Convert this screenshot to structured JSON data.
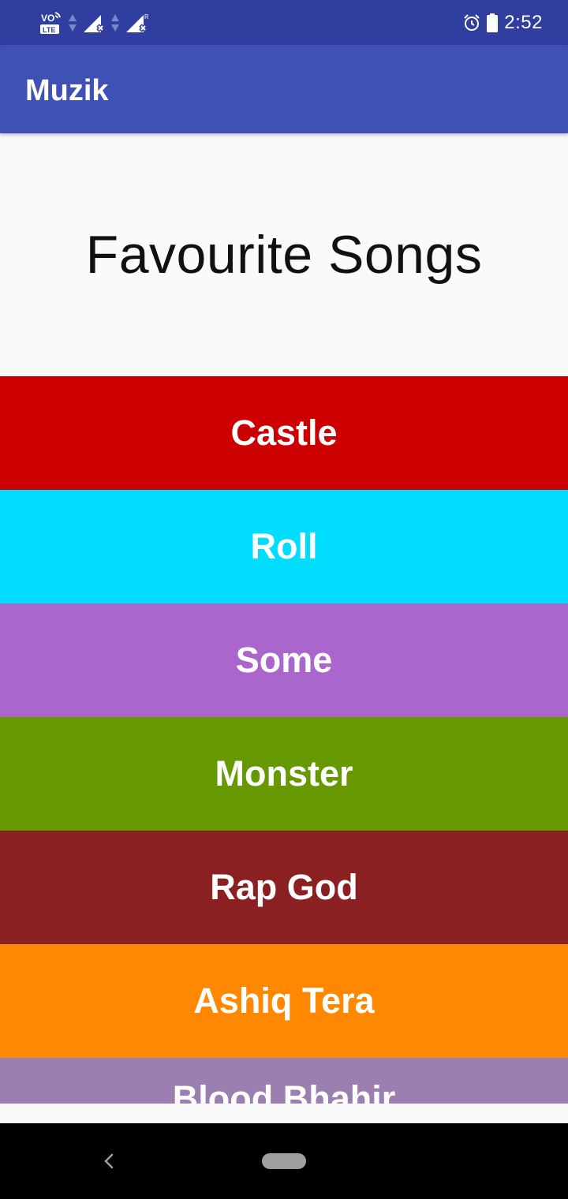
{
  "status_bar": {
    "time": "2:52",
    "volte_top": "VO",
    "volte_bottom": "LTE",
    "roaming": "R",
    "icons": [
      "volte-icon",
      "data-arrows-icon",
      "signal-icon",
      "signal-icon",
      "alarm-icon",
      "battery-icon"
    ]
  },
  "app_bar": {
    "title": "Muzik"
  },
  "header": {
    "title": "Favourite Songs"
  },
  "songs": [
    {
      "title": "Castle",
      "color": "#cc0000"
    },
    {
      "title": "Roll",
      "color": "#00ddff"
    },
    {
      "title": "Some",
      "color": "#aa66cc"
    },
    {
      "title": "Monster",
      "color": "#669900"
    },
    {
      "title": "Rap God",
      "color": "#8b2022"
    },
    {
      "title": "Ashiq Tera",
      "color": "#ff8800"
    },
    {
      "title": "Blood Bhahir",
      "color": "#9b7fb0"
    }
  ],
  "nav_bar": {
    "icons": [
      "back-icon",
      "home-pill-icon"
    ]
  }
}
